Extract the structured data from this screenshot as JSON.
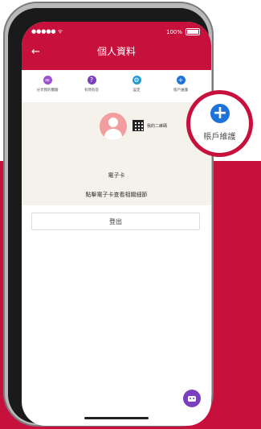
{
  "status_bar": {
    "carrier": "●●●●● ᯤ",
    "battery_text": "100%"
  },
  "header": {
    "back_icon": "back-arrow-icon",
    "title": "個人資料"
  },
  "toolbar": {
    "items": [
      {
        "label": "分享我的體驗",
        "icon": "share-icon",
        "color": "#9b4fd1"
      },
      {
        "label": "有問有答",
        "icon": "qa-icon",
        "color": "#7a3fbf"
      },
      {
        "label": "設定",
        "icon": "gear-icon",
        "color": "#1e9bd8"
      },
      {
        "label": "賬戶維護",
        "icon": "plus-circle-icon",
        "color": "#1e73d8"
      }
    ]
  },
  "profile_card": {
    "qr_label": "我的二維碼",
    "ecard_label": "電子卡",
    "hint": "點擊電子卡查看相關細節"
  },
  "logout_label": "登出",
  "callout": {
    "label": "賬戶維護",
    "icon": "plus-circle-icon"
  },
  "colors": {
    "brand": "#c8103d",
    "accent_blue": "#1e73d8",
    "card_bg": "#f5f1eb"
  }
}
